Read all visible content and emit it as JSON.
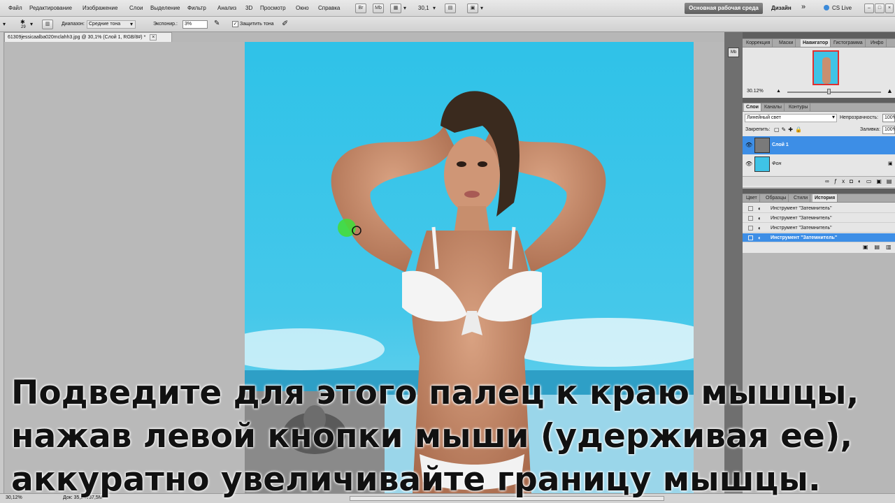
{
  "menu": {
    "items": [
      "Файл",
      "Редактирование",
      "Изображение",
      "Слои",
      "Выделение",
      "Фильтр",
      "Анализ",
      "3D",
      "Просмотр",
      "Окно",
      "Справка"
    ],
    "zoom": "30,1",
    "workspace": "Основная рабочая среда",
    "design": "Дизайн",
    "more": "»",
    "cslive": "CS Live"
  },
  "options": {
    "brush_size": "29",
    "range_label": "Диапазон:",
    "range_value": "Средние тона",
    "exposure_label": "Экспонир.:",
    "exposure_value": "3%",
    "protect_label": "Защитить тона",
    "protect_checked": "✓"
  },
  "document": {
    "tab_title": "61309jessicaalba020mclahh3.jpg @ 30,1% (Слой 1, RGB/8#) *",
    "close": "×"
  },
  "status": {
    "zoom": "30,12%",
    "doc": "Док: 35,2M/37,5M"
  },
  "panels": {
    "navigator_tabs": [
      "Коррекция",
      "Маски",
      "Навигатор",
      "Гистограмма",
      "Инфо"
    ],
    "navigator_zoom": "30.12%",
    "layers_tabs": [
      "Слои",
      "Каналы",
      "Контуры"
    ],
    "blend_mode": "Линейный свет",
    "opacity_label": "Непрозрачность:",
    "opacity_value": "100%",
    "lock_label": "Закрепить:",
    "fill_label": "Заливка:",
    "fill_value": "100%",
    "layers": [
      {
        "name": "Слой 1",
        "selected": true
      },
      {
        "name": "Фон",
        "selected": false
      }
    ],
    "history_tabs": [
      "Цвет",
      "Образцы",
      "Стили",
      "История"
    ],
    "history": [
      "Инструмент \"Затемнитель\"",
      "Инструмент \"Затемнитель\"",
      "Инструмент \"Затемнитель\"",
      "Инструмент \"Затемнитель\""
    ]
  },
  "subtitle": {
    "line1": "Подведите для этого палец к краю мышцы,",
    "line2": "нажав левой кнопки мыши (удерживая ее),",
    "line3": "аккуратно увеличивайте границу мышцы."
  },
  "colors": {
    "sky": "#3fc3e6",
    "selection": "#3d8ee6",
    "workspace_btn": "#6a6a6a"
  }
}
